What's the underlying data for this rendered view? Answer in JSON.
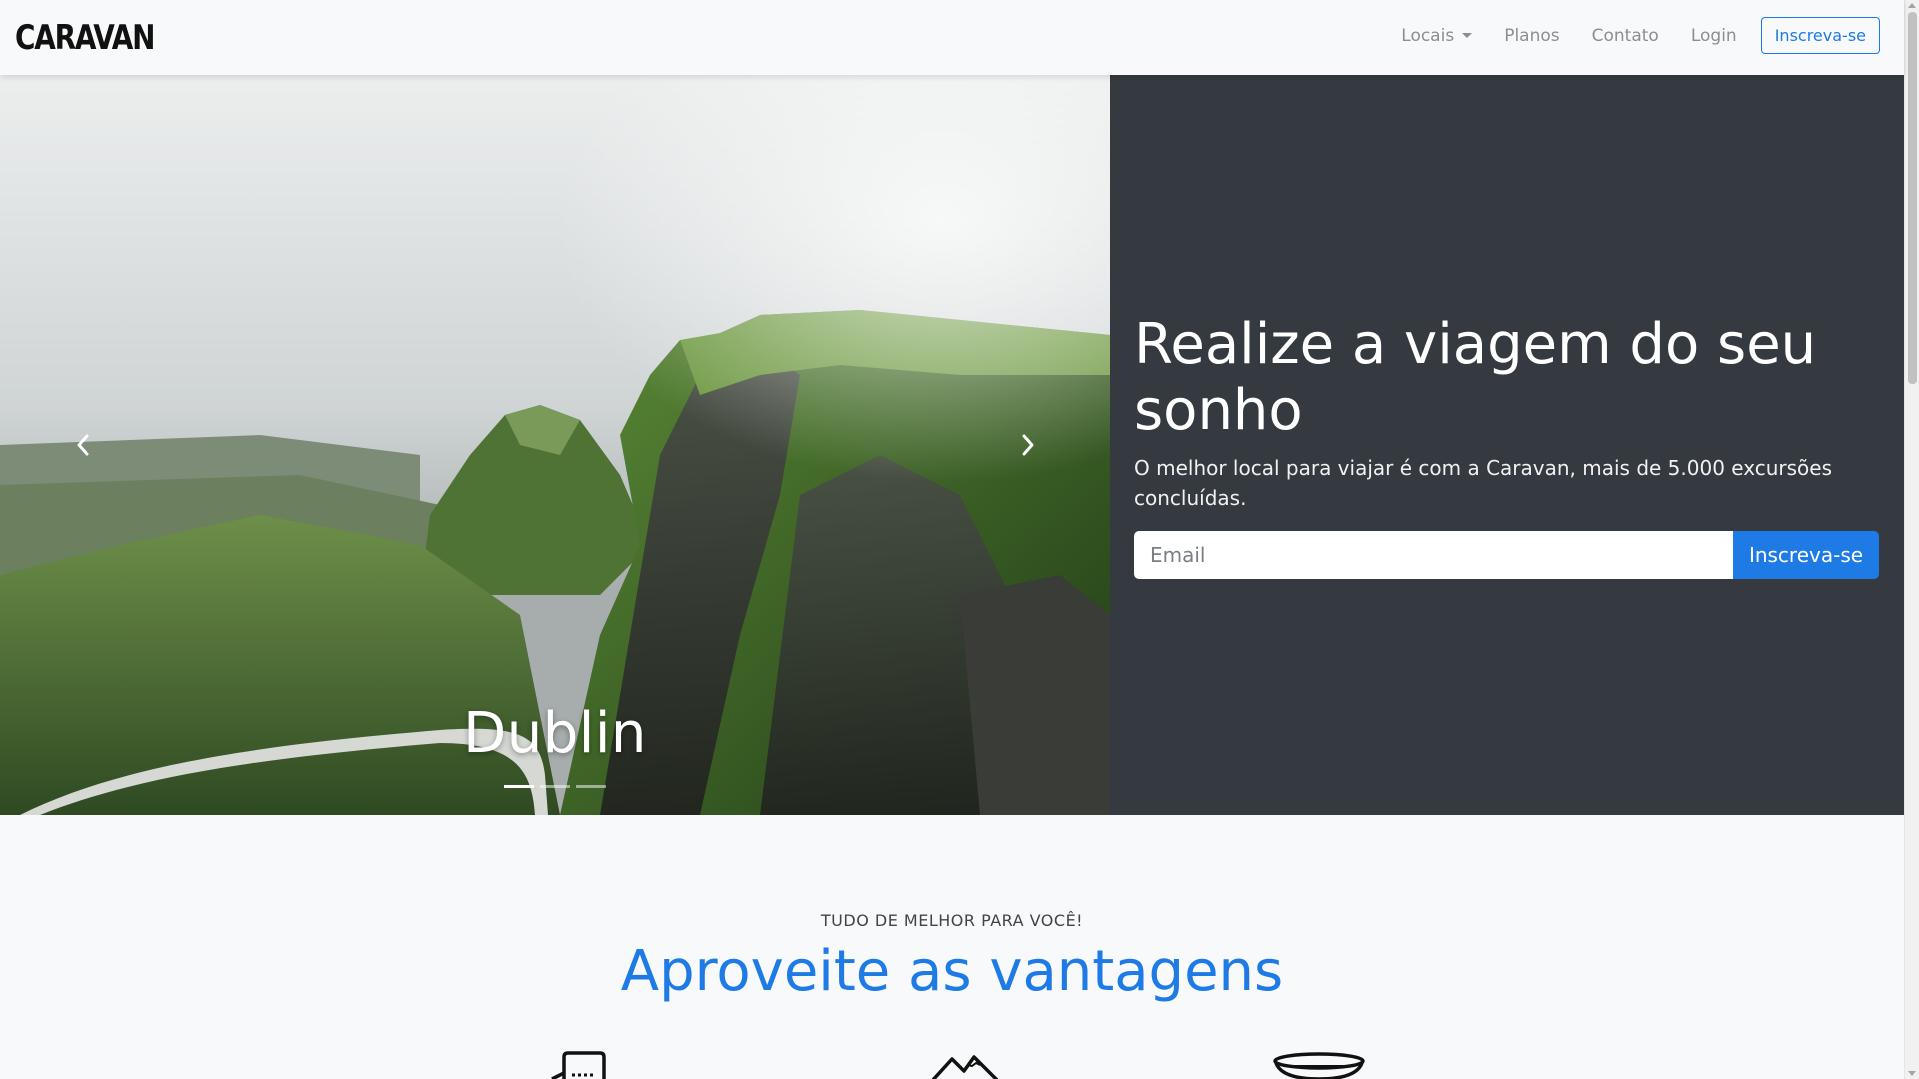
{
  "navbar": {
    "brand": "CARAVAN",
    "links": [
      {
        "label": "Locais",
        "dropdown": true
      },
      {
        "label": "Planos"
      },
      {
        "label": "Contato"
      },
      {
        "label": "Login"
      }
    ],
    "cta_label": "Inscreva-se"
  },
  "carousel": {
    "caption": "Dublin",
    "indicator_count": 3,
    "active_index": 0
  },
  "hero": {
    "title": "Realize a viagem do seu sonho",
    "subtitle": "O melhor local para viajar é com a Caravan, mais de 5.000 excursões concluídas.",
    "email_placeholder": "Email",
    "submit_label": "Inscreva-se"
  },
  "features": {
    "eyebrow": "TUDO DE MELHOR PARA VOCÊ!",
    "title": "Aproveite as vantagens",
    "icons": [
      "chat-bubble-icon",
      "mountains-icon",
      "hot-air-balloon-icon"
    ]
  },
  "colors": {
    "primary": "#1e7be6",
    "dark": "#343a40",
    "light": "#f8f9fa"
  }
}
